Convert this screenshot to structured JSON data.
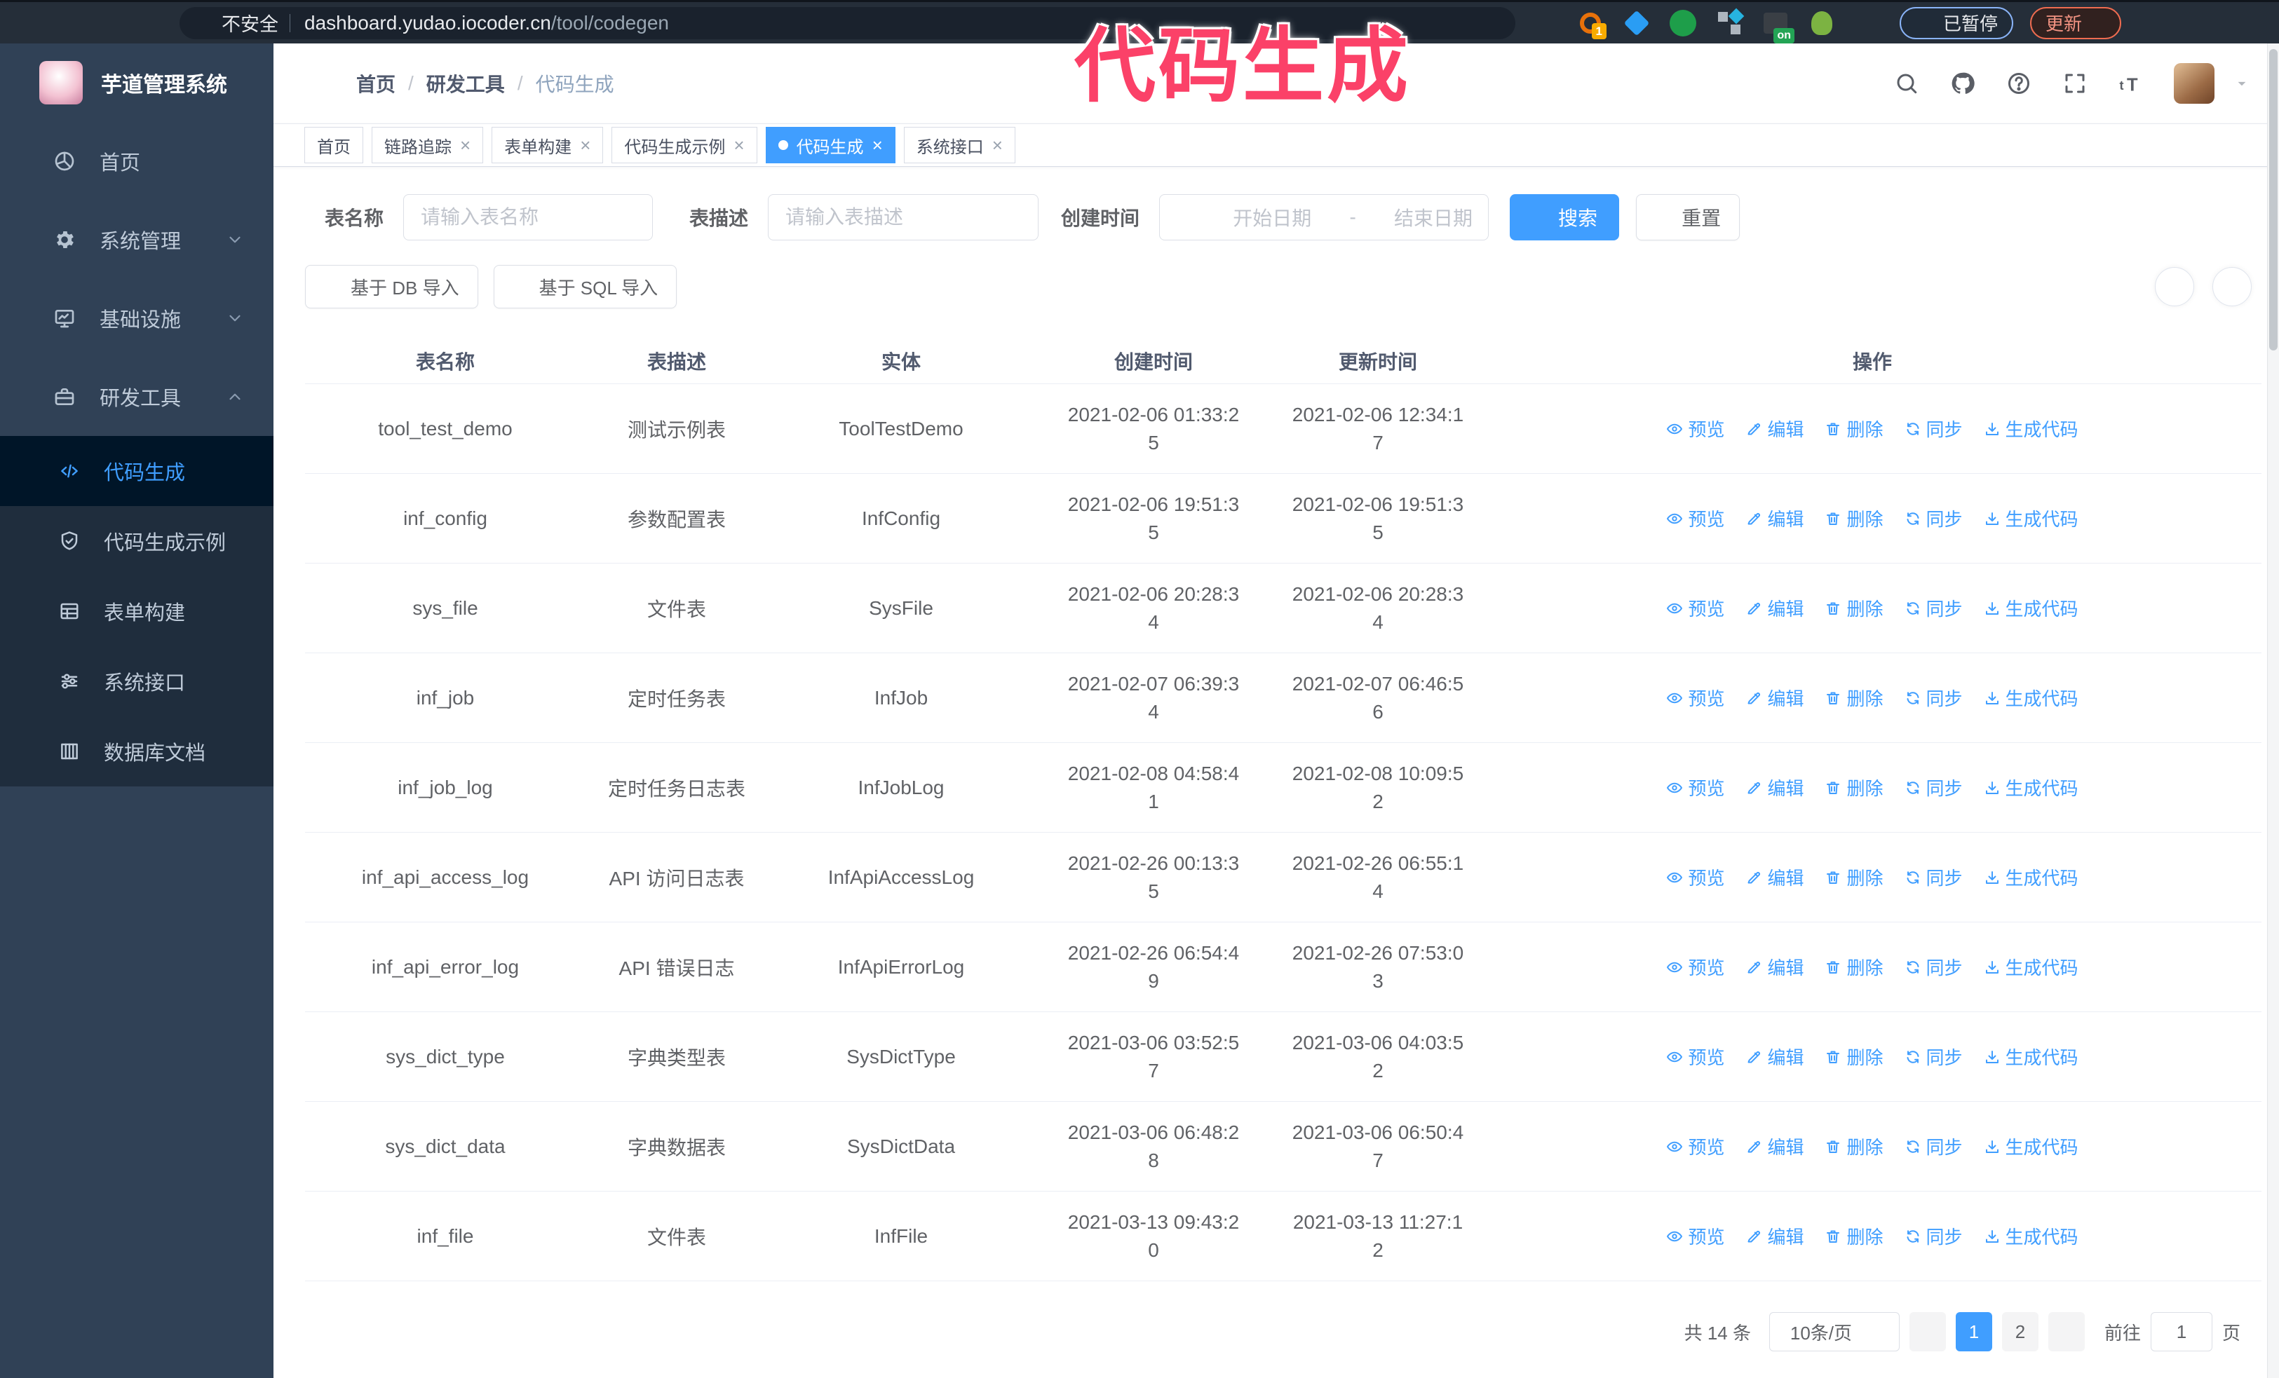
{
  "browser": {
    "security_label": "不安全",
    "url_host": "dashboard.yudao.iocoder.cn",
    "url_path": "/tool/codegen",
    "badge_one": "1",
    "badge_on": "on",
    "paused_label": "已暂停",
    "update_label": "更新"
  },
  "annotation": {
    "text": "代码生成",
    "color": "#fb4168"
  },
  "sidebar": {
    "title": "芋道管理系统",
    "items": [
      {
        "key": "home",
        "label": "首页",
        "icon": "dashboard"
      },
      {
        "key": "system",
        "label": "系统管理",
        "icon": "gear",
        "chevron": "down"
      },
      {
        "key": "infra",
        "label": "基础设施",
        "icon": "monitor",
        "chevron": "down"
      },
      {
        "key": "devtools",
        "label": "研发工具",
        "icon": "toolbox",
        "chevron": "up",
        "expanded": true
      }
    ],
    "submenu": [
      {
        "key": "codegen",
        "label": "代码生成",
        "icon": "code",
        "active": true
      },
      {
        "key": "codegen-example",
        "label": "代码生成示例",
        "icon": "shieldcheck"
      },
      {
        "key": "form-build",
        "label": "表单构建",
        "icon": "form"
      },
      {
        "key": "system-api",
        "label": "系统接口",
        "icon": "sliders"
      },
      {
        "key": "db-doc",
        "label": "数据库文档",
        "icon": "dbdoc"
      }
    ]
  },
  "header": {
    "breadcrumb": [
      "首页",
      "研发工具",
      "代码生成"
    ],
    "breadcrumb_separator": "/",
    "icons": [
      {
        "key": "search",
        "icon": "search"
      },
      {
        "key": "github",
        "icon": "github"
      },
      {
        "key": "help",
        "icon": "help"
      },
      {
        "key": "fullscreen",
        "icon": "fullscreen"
      },
      {
        "key": "font-size",
        "icon": "textsize"
      }
    ]
  },
  "tabs": [
    {
      "label": "首页",
      "closable": false,
      "active": false
    },
    {
      "label": "链路追踪",
      "closable": true,
      "active": false
    },
    {
      "label": "表单构建",
      "closable": true,
      "active": false
    },
    {
      "label": "代码生成示例",
      "closable": true,
      "active": false
    },
    {
      "label": "代码生成",
      "closable": true,
      "active": true
    },
    {
      "label": "系统接口",
      "closable": true,
      "active": false
    }
  ],
  "filters": {
    "table_name_label": "表名称",
    "table_name_placeholder": "请输入表名称",
    "table_desc_label": "表描述",
    "table_desc_placeholder": "请输入表描述",
    "create_time_label": "创建时间",
    "date_start_placeholder": "开始日期",
    "date_separator": "-",
    "date_end_placeholder": "结束日期",
    "search_label": "搜索",
    "reset_label": "重置"
  },
  "toolbar": {
    "import_db_label": "基于 DB 导入",
    "import_sql_label": "基于 SQL 导入"
  },
  "table": {
    "columns": [
      "表名称",
      "表描述",
      "实体",
      "创建时间",
      "更新时间",
      "操作"
    ],
    "actions": [
      {
        "key": "preview",
        "label": "预览",
        "icon": "eye"
      },
      {
        "key": "edit",
        "label": "编辑",
        "icon": "edit"
      },
      {
        "key": "delete",
        "label": "删除",
        "icon": "trash"
      },
      {
        "key": "sync",
        "label": "同步",
        "icon": "refresh"
      },
      {
        "key": "generate-code",
        "label": "生成代码",
        "icon": "download"
      }
    ],
    "rows": [
      [
        "tool_test_demo",
        "测试示例表",
        "ToolTestDemo",
        "2021-02-06 01:33:25",
        "2021-02-06 12:34:17"
      ],
      [
        "inf_config",
        "参数配置表",
        "InfConfig",
        "2021-02-06 19:51:35",
        "2021-02-06 19:51:35"
      ],
      [
        "sys_file",
        "文件表",
        "SysFile",
        "2021-02-06 20:28:34",
        "2021-02-06 20:28:34"
      ],
      [
        "inf_job",
        "定时任务表",
        "InfJob",
        "2021-02-07 06:39:34",
        "2021-02-07 06:46:56"
      ],
      [
        "inf_job_log",
        "定时任务日志表",
        "InfJobLog",
        "2021-02-08 04:58:41",
        "2021-02-08 10:09:52"
      ],
      [
        "inf_api_access_log",
        "API 访问日志表",
        "InfApiAccessLog",
        "2021-02-26 00:13:35",
        "2021-02-26 06:55:14"
      ],
      [
        "inf_api_error_log",
        "API 错误日志",
        "InfApiErrorLog",
        "2021-02-26 06:54:49",
        "2021-02-26 07:53:03"
      ],
      [
        "sys_dict_type",
        "字典类型表",
        "SysDictType",
        "2021-03-06 03:52:57",
        "2021-03-06 04:03:52"
      ],
      [
        "sys_dict_data",
        "字典数据表",
        "SysDictData",
        "2021-03-06 06:48:28",
        "2021-03-06 06:50:47"
      ],
      [
        "inf_file",
        "文件表",
        "InfFile",
        "2021-03-13 09:43:20",
        "2021-03-13 11:27:12"
      ]
    ]
  },
  "pagination": {
    "total_label": "共 14 条",
    "page_size": "10条/页",
    "pages": [
      "1",
      "2"
    ],
    "active_page": "1",
    "goto_label": "前往",
    "goto_value": "1",
    "page_label": "页"
  }
}
